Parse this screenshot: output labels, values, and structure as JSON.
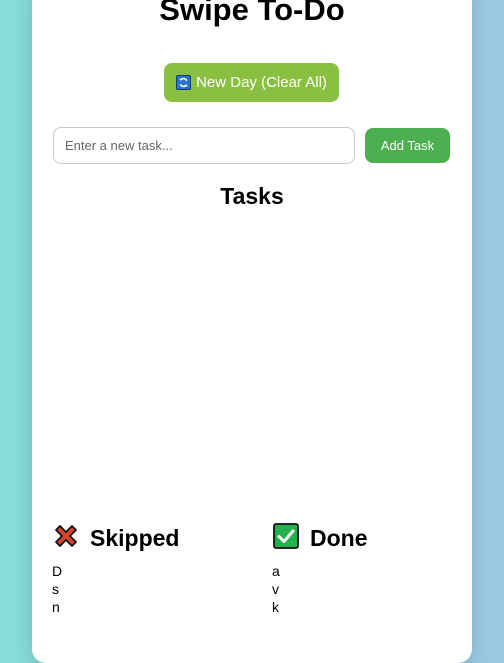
{
  "app": {
    "title": "Swipe To-Do"
  },
  "toolbar": {
    "new_day_label": "New Day (Clear All)"
  },
  "input": {
    "placeholder": "Enter a new task...",
    "value": "",
    "add_label": "Add Task"
  },
  "tasks": {
    "heading": "Tasks",
    "items": []
  },
  "skipped": {
    "title": "Skipped",
    "icon": "cross-mark-icon",
    "items": [
      "D",
      "s",
      "n"
    ]
  },
  "done": {
    "title": "Done",
    "icon": "check-mark-button-icon",
    "items": [
      "a",
      "v",
      "k"
    ]
  },
  "colors": {
    "new_day_button": "#8ac041",
    "add_button": "#4caf50",
    "skipped_icon": "#d9442b",
    "done_icon": "#22b14c"
  }
}
